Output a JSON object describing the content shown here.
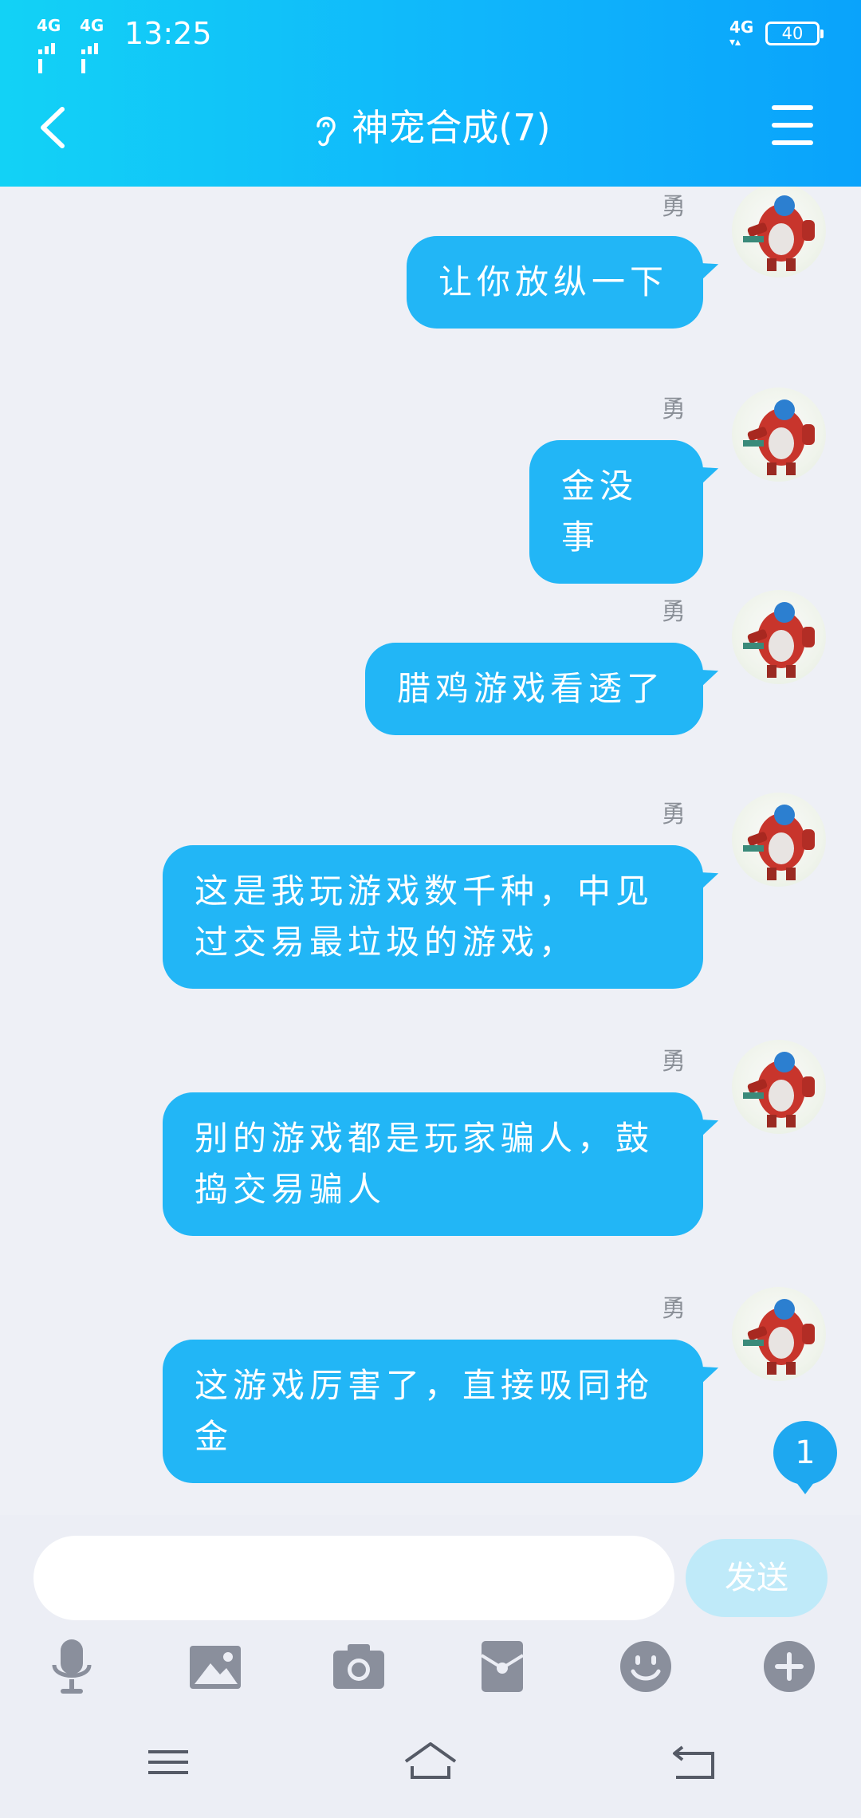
{
  "status_bar": {
    "signal_1": "4G",
    "signal_2": "4G",
    "time": "13:25",
    "network_right": "4G",
    "battery": "40"
  },
  "header": {
    "title": "神宠合成(7)",
    "back_icon": "chevron-left-icon",
    "ear_icon": "ear-icon",
    "menu_icon": "hamburger-menu-icon"
  },
  "messages": [
    {
      "sender": "勇",
      "text": "让你放纵一下"
    },
    {
      "sender": "勇",
      "text": "金没事"
    },
    {
      "sender": "勇",
      "text": "腊鸡游戏看透了"
    },
    {
      "sender": "勇",
      "text": "这是我玩游戏数千种，中见过交易最垃圾的游戏，"
    },
    {
      "sender": "勇",
      "text": "别的游戏都是玩家骗人，鼓捣交易骗人"
    },
    {
      "sender": "勇",
      "text": "这游戏厉害了，直接吸同抢金"
    }
  ],
  "unread_badge": "1",
  "composer": {
    "input_value": "",
    "send_label": "发送"
  },
  "toolbar_icons": [
    "microphone-icon",
    "image-icon",
    "camera-icon",
    "red-packet-icon",
    "emoji-icon",
    "plus-icon"
  ],
  "nav_icons": [
    "menu-icon",
    "home-icon",
    "back-icon"
  ],
  "colors": {
    "header_gradient_start": "#12d2f6",
    "header_gradient_end": "#0aa3fb",
    "bubble": "#22b6f6",
    "background": "#eef0f6",
    "send_button": "#bfeaf9",
    "icon_gray": "#8a8f9c"
  }
}
